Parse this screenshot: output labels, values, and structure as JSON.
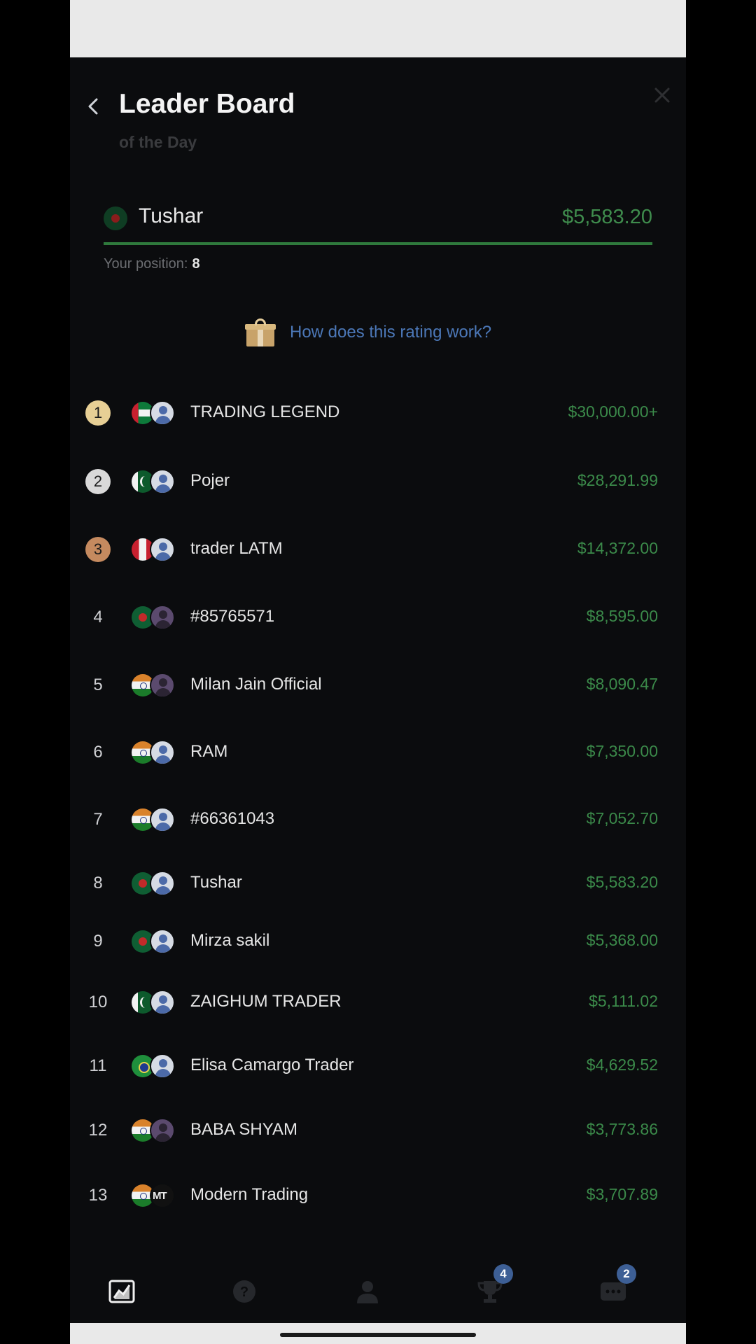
{
  "header": {
    "title": "Leader Board",
    "subtitle": "of the Day",
    "back_icon": "chevron-left-icon",
    "close_icon": "close-icon"
  },
  "me": {
    "name": "Tushar",
    "amount": "$5,583.20",
    "position_label": "Your position:",
    "position_value": "8",
    "progress": 1.0
  },
  "how_link": "How does this rating work?",
  "leaders": [
    {
      "rank": "1",
      "name": "TRADING LEGEND",
      "amount": "$30,000.00+",
      "flag": "ae",
      "avatar": "default"
    },
    {
      "rank": "2",
      "name": "Pojer",
      "amount": "$28,291.99",
      "flag": "pk",
      "avatar": "default"
    },
    {
      "rank": "3",
      "name": "trader LATM",
      "amount": "$14,372.00",
      "flag": "pe",
      "avatar": "default"
    },
    {
      "rank": "4",
      "name": "#85765571",
      "amount": "$8,595.00",
      "flag": "bd",
      "avatar": "photo"
    },
    {
      "rank": "5",
      "name": "Milan Jain Official",
      "amount": "$8,090.47",
      "flag": "in",
      "avatar": "photo"
    },
    {
      "rank": "6",
      "name": "RAM",
      "amount": "$7,350.00",
      "flag": "in",
      "avatar": "default"
    },
    {
      "rank": "7",
      "name": "#66361043",
      "amount": "$7,052.70",
      "flag": "in",
      "avatar": "default"
    },
    {
      "rank": "8",
      "name": "Tushar",
      "amount": "$5,583.20",
      "flag": "bd",
      "avatar": "default"
    },
    {
      "rank": "9",
      "name": "Mirza sakil",
      "amount": "$5,368.00",
      "flag": "bd",
      "avatar": "default"
    },
    {
      "rank": "10",
      "name": "ZAIGHUM TRADER",
      "amount": "$5,111.02",
      "flag": "pk",
      "avatar": "default"
    },
    {
      "rank": "11",
      "name": "Elisa Camargo Trader",
      "amount": "$4,629.52",
      "flag": "br",
      "avatar": "default"
    },
    {
      "rank": "12",
      "name": "BABA SHYAM",
      "amount": "$3,773.86",
      "flag": "in",
      "avatar": "photo"
    },
    {
      "rank": "13",
      "name": "Modern Trading",
      "amount": "$3,707.89",
      "flag": "in",
      "avatar": "text",
      "avatar_text": "MT"
    }
  ],
  "tabs": [
    {
      "icon": "chart-icon",
      "active": true,
      "badge": ""
    },
    {
      "icon": "help-icon",
      "active": false,
      "badge": ""
    },
    {
      "icon": "profile-icon",
      "active": false,
      "badge": ""
    },
    {
      "icon": "trophy-icon",
      "active": false,
      "badge": "4"
    },
    {
      "icon": "chat-icon",
      "active": false,
      "badge": "2"
    }
  ],
  "colors": {
    "background": "#0b0c0e",
    "amount_green": "#3b8a4a",
    "link_blue": "#4c78b8",
    "badge_blue": "#3d5f95",
    "gold": "#e7cf95",
    "silver": "#d9d9d9",
    "bronze": "#c58a5f"
  }
}
